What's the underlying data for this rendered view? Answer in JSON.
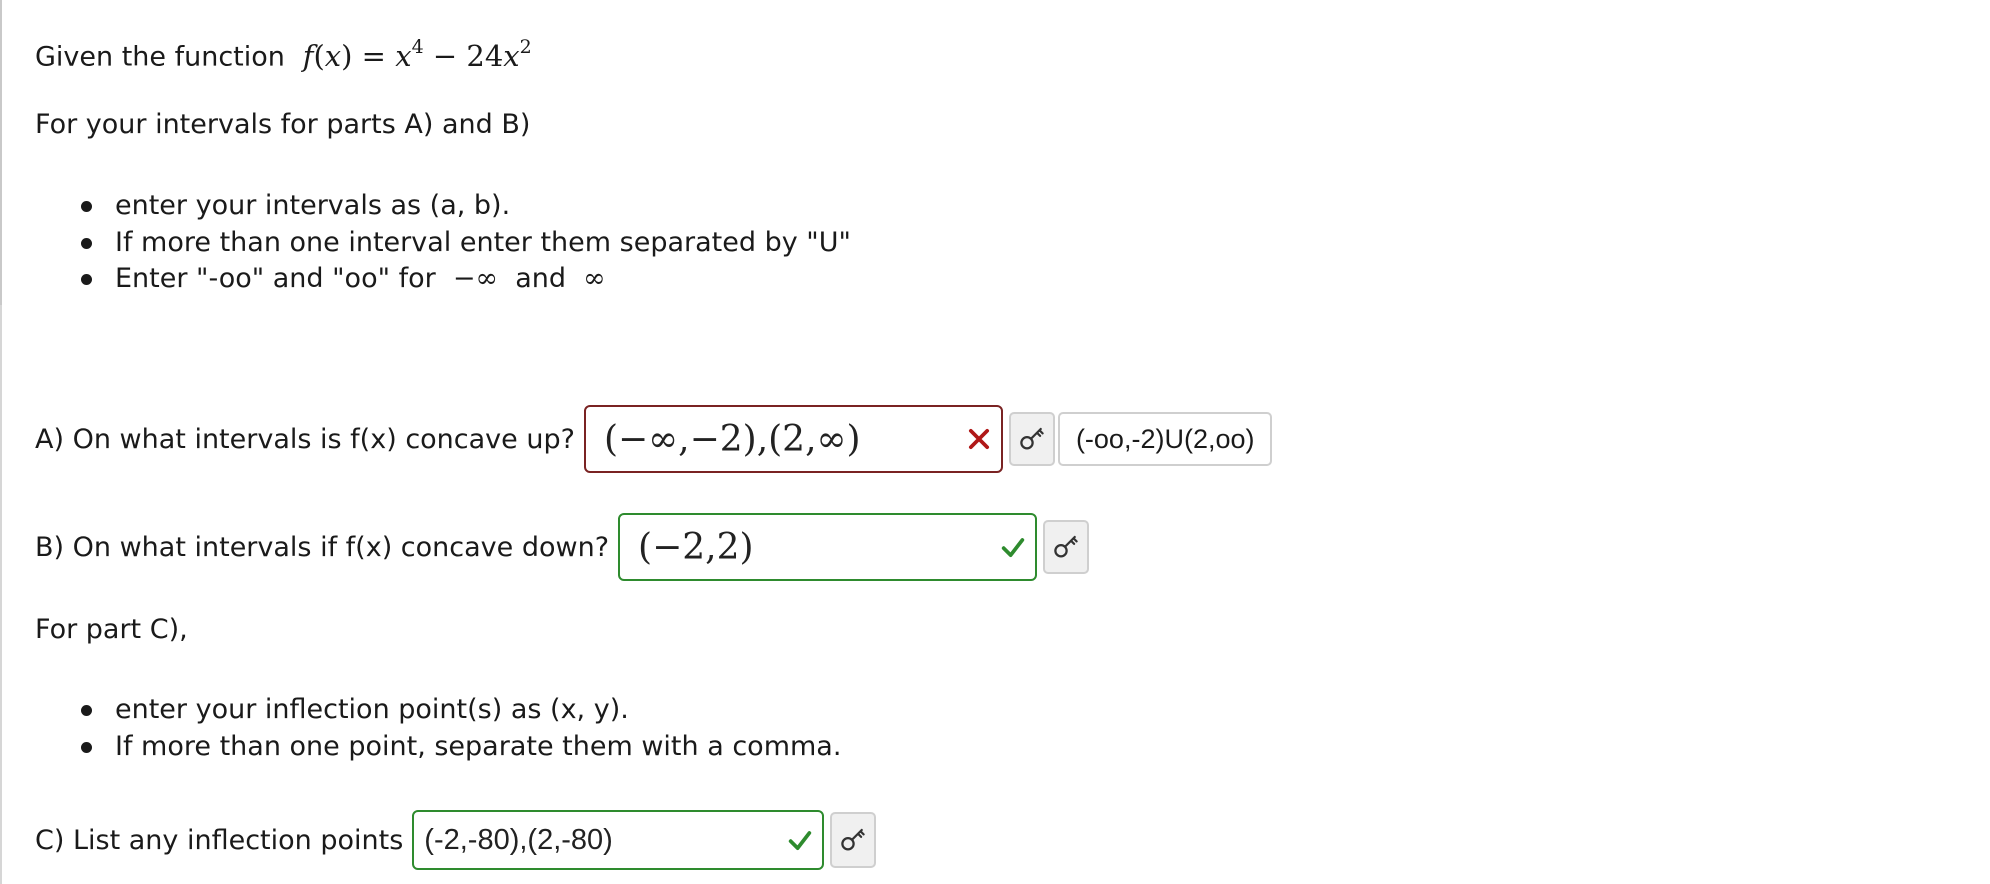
{
  "intro": {
    "lead": "Given the function",
    "function_latex": "f(x) = x^4 - 24x^2"
  },
  "instructions_ab": {
    "heading": "For your intervals for parts A) and B)",
    "bullets": [
      "enter your intervals as (a, b).",
      "If more than one interval enter them separated by \"U\"",
      "Enter \"-oo\" and \"oo\" for"
    ],
    "bullet3_and": "and"
  },
  "question_a": {
    "label": "A)  On what intervals is f(x) concave up?",
    "answer_display": "(−∞,−2),(2,∞)",
    "status": "incorrect",
    "correct_answer": "(-oo,-2)U(2,oo)"
  },
  "question_b": {
    "label": "B)  On what intervals if f(x) concave down?",
    "answer_display": "(−2,2)",
    "status": "correct"
  },
  "instructions_c": {
    "heading": "For part C),",
    "bullets": [
      "enter your inflection point(s) as  (x, y).",
      "If more than one point, separate them with a comma."
    ]
  },
  "question_c": {
    "label": "C)  List any inflection points",
    "answer_display": "(-2,-80),(2,-80)",
    "status": "correct"
  },
  "colors": {
    "incorrect_border": "#7a2323",
    "correct_border": "#2e8b2e",
    "incorrect_mark": "#b01818",
    "correct_mark": "#2e8b2e"
  },
  "icons": {
    "incorrect": "x-mark-icon",
    "correct": "check-mark-icon",
    "key": "key-icon"
  }
}
